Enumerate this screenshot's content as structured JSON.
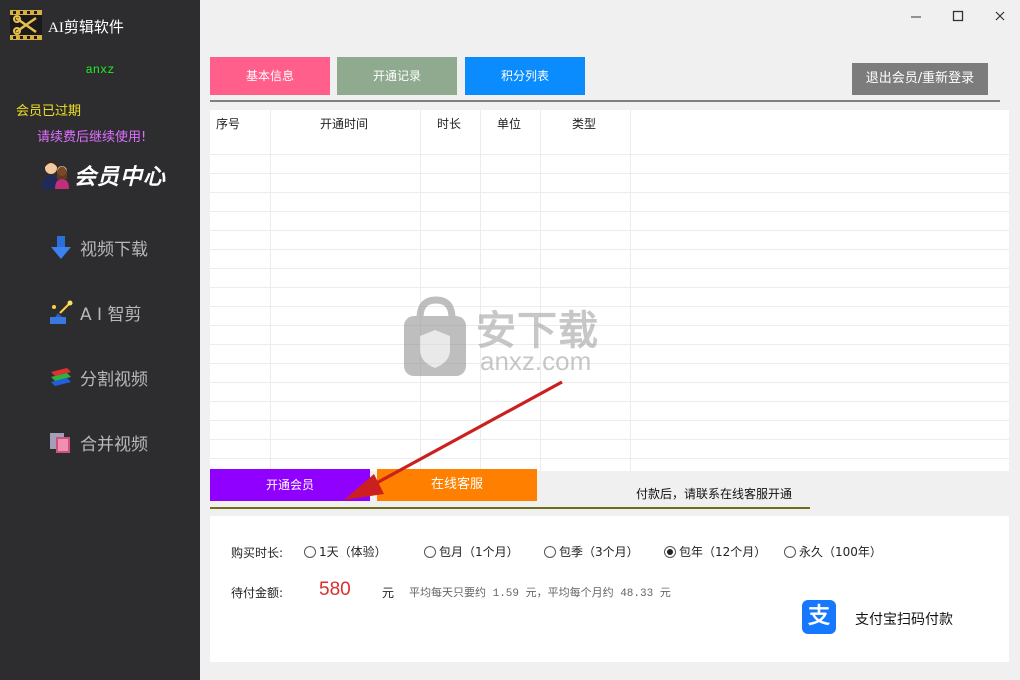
{
  "app": {
    "title": "AI剪辑软件",
    "logo_icon": "scissors-film-icon"
  },
  "window": {
    "minimize_icon": "minimize-icon",
    "maximize_icon": "maximize-icon",
    "close_icon": "close-icon"
  },
  "sidebar": {
    "username": "anxz",
    "vip_status": "会员已过期",
    "renew_tip": "请续费后继续使用!",
    "member_center": "会员中心",
    "items": [
      {
        "label": "视频下载",
        "icon": "download-arrow-icon"
      },
      {
        "label": "A I 智剪",
        "icon": "ai-edit-icon"
      },
      {
        "label": "分割视频",
        "icon": "split-layers-icon"
      },
      {
        "label": "合并视频",
        "icon": "merge-video-icon"
      }
    ]
  },
  "tabs": {
    "basic_info": "基本信息",
    "open_records": "开通记录",
    "points_list": "积分列表",
    "logout": "退出会员/重新登录"
  },
  "table": {
    "columns": [
      "序号",
      "开通时间",
      "时长",
      "单位",
      "类型"
    ],
    "rows": []
  },
  "watermark": {
    "cn": "安下载",
    "en": "anxz.com"
  },
  "actions": {
    "open_member": "开通会员",
    "online_service": "在线客服",
    "pay_tip": "付款后，请联系在线客服开通"
  },
  "payment": {
    "duration_label": "购买时长:",
    "options": [
      "1天（体验）",
      "包月（1个月）",
      "包季（3个月）",
      "包年（12个月）",
      "永久（100年）"
    ],
    "selected_option": "包年（12个月）",
    "amount_label": "待付金额:",
    "amount": "580",
    "currency": "元",
    "avg_note": "平均每天只要约 1.59 元，平均每个月约 48.33 元",
    "alipay_label": "支付宝扫码付款"
  },
  "colors": {
    "sidebar_bg": "#2d2d30",
    "tab_basic": "#ff5f8a",
    "tab_records": "#8faa8f",
    "tab_points": "#0a8cff",
    "logout_bg": "#7c7c7c",
    "open_member_bg": "#8f00ff",
    "service_bg": "#ff8000",
    "amount_color": "#d83030",
    "alipay_blue": "#1677ff"
  }
}
